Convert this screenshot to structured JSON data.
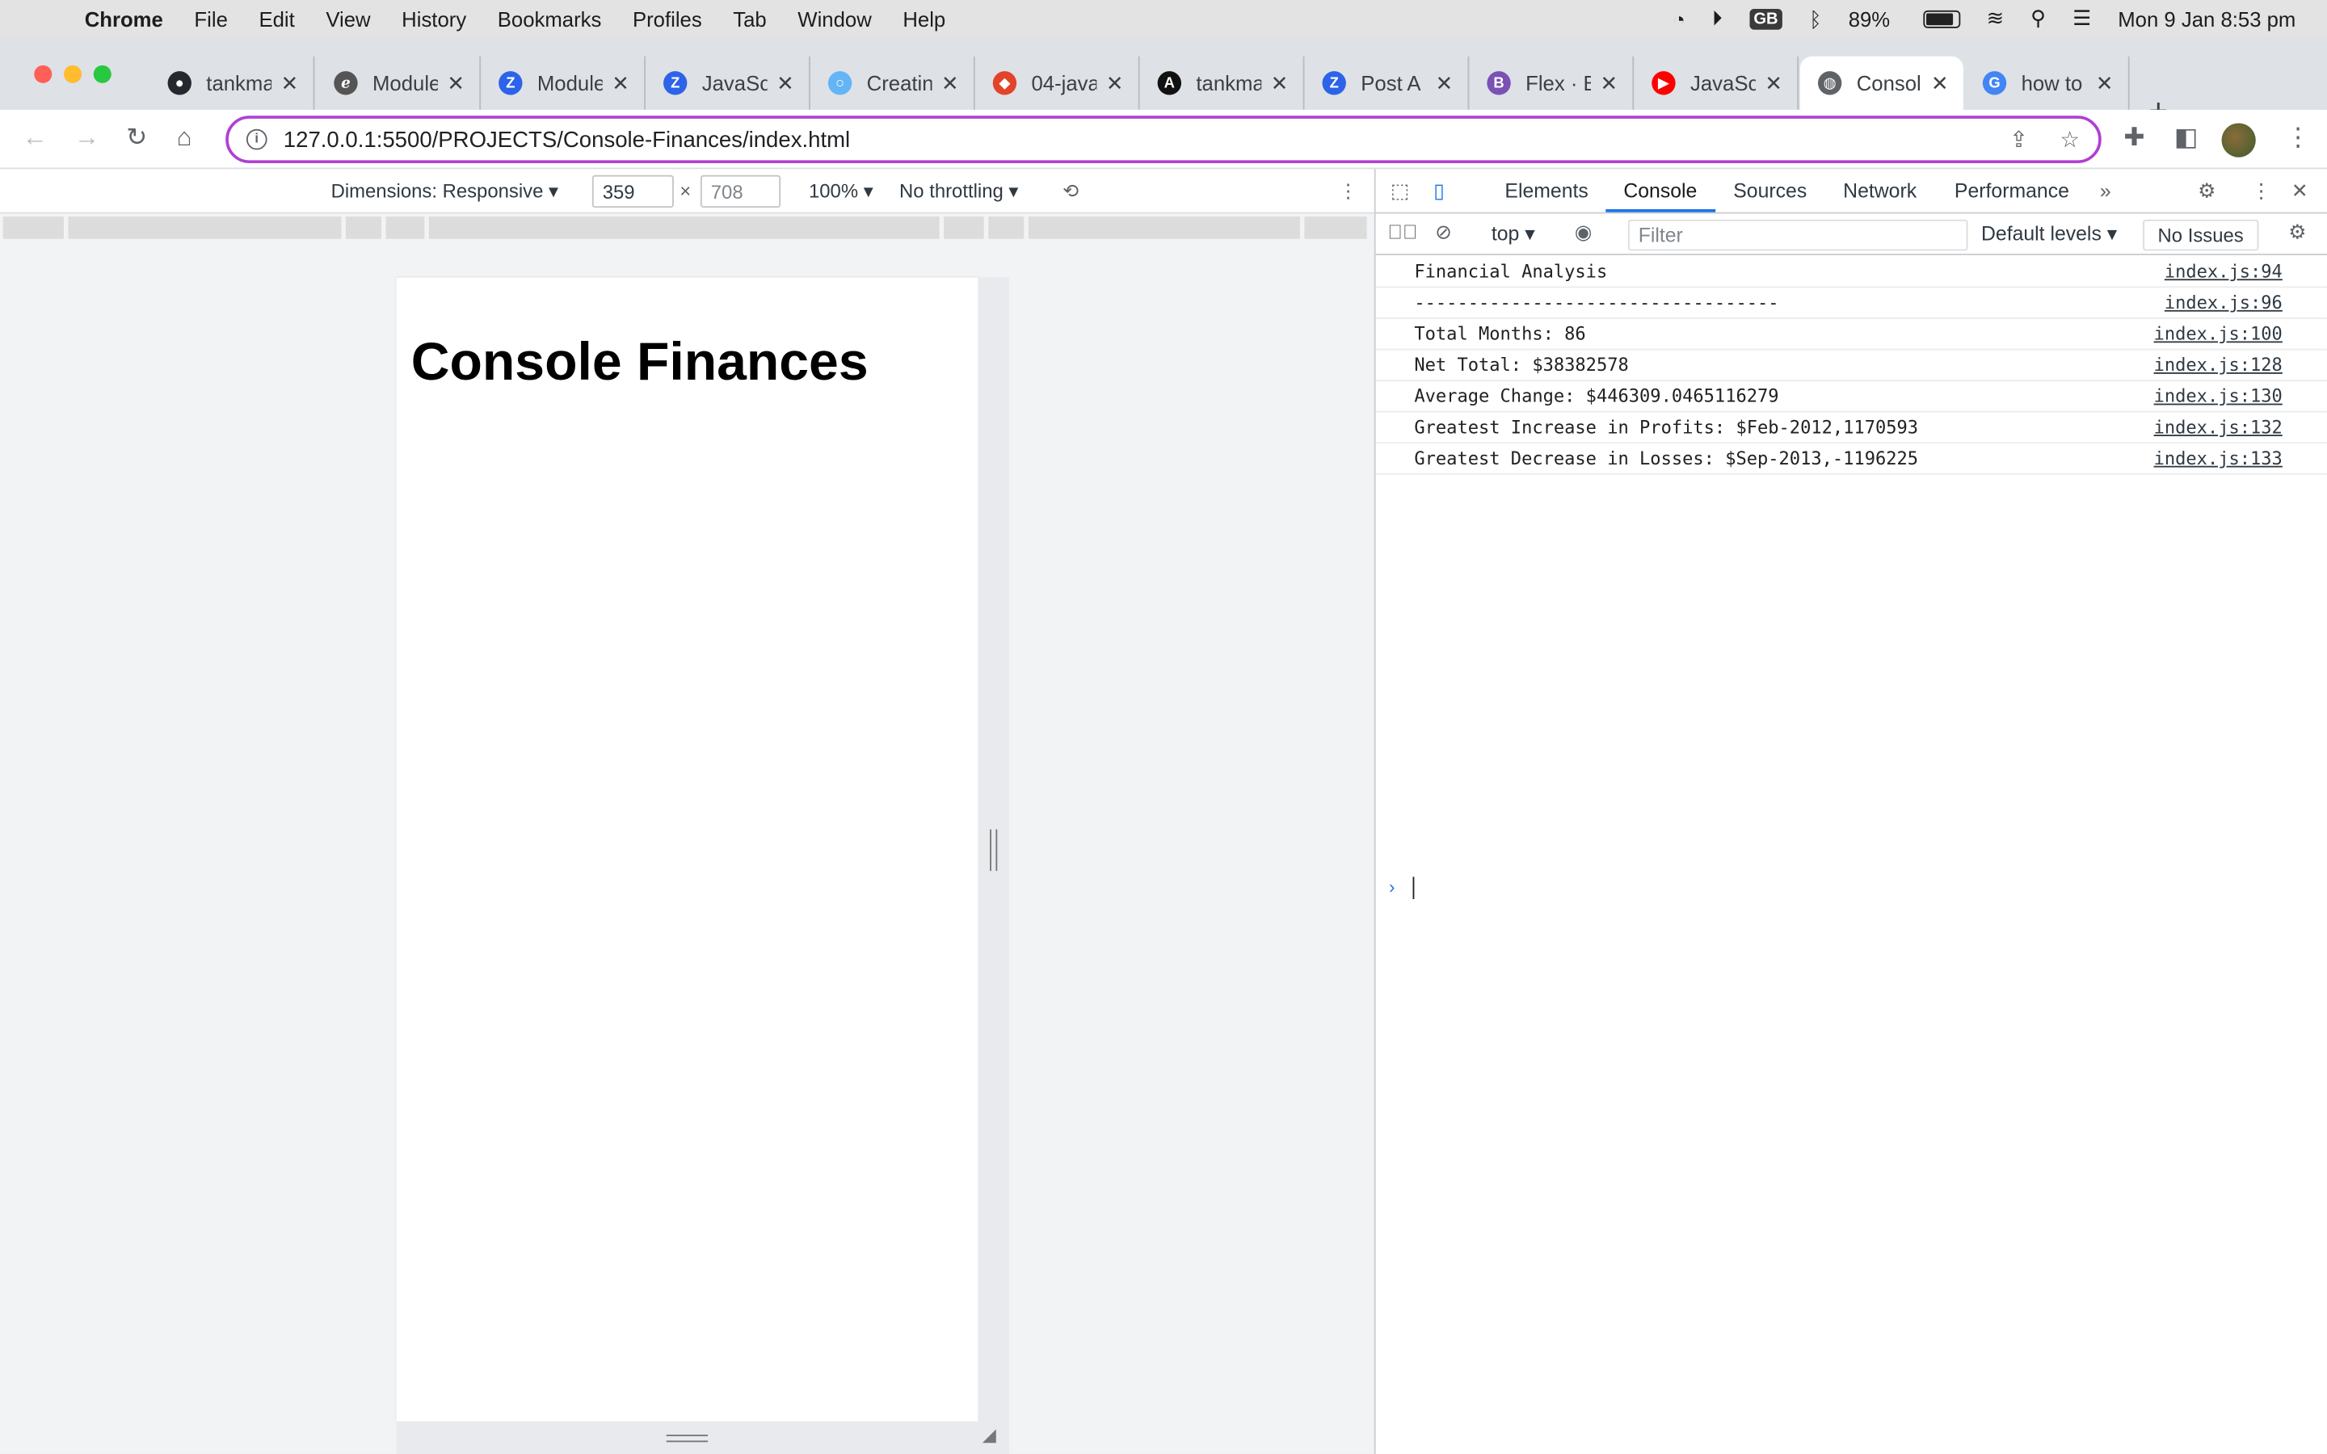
{
  "menubar": {
    "app": "Chrome",
    "items": [
      "File",
      "Edit",
      "View",
      "History",
      "Bookmarks",
      "Profiles",
      "Tab",
      "Window",
      "Help"
    ],
    "badge": "GB",
    "battery": "89%",
    "clock": "Mon 9 Jan  8:53 pm"
  },
  "tabs": [
    {
      "title": "tankma",
      "icon": "github-icon",
      "color": "#24292f"
    },
    {
      "title": "Module",
      "icon": "edx-icon",
      "color": "#555555"
    },
    {
      "title": "Module",
      "icon": "zoom-icon",
      "color": "#2d63e8"
    },
    {
      "title": "JavaSc",
      "icon": "zoom-icon",
      "color": "#2d63e8"
    },
    {
      "title": "Creatin",
      "icon": "circle-icon",
      "color": "#64b5f6"
    },
    {
      "title": "04-java",
      "icon": "gitlab-icon",
      "color": "#e24329"
    },
    {
      "title": "tankma",
      "icon": "aol-icon",
      "color": "#111111"
    },
    {
      "title": "Post A",
      "icon": "zoom-icon",
      "color": "#2d63e8"
    },
    {
      "title": "Flex · B",
      "icon": "bootstrap-icon",
      "color": "#7952b3"
    },
    {
      "title": "JavaSc",
      "icon": "youtube-icon",
      "color": "#ff0000"
    },
    {
      "title": "Consol",
      "icon": "globe-icon",
      "color": "#5f6368",
      "active": true
    },
    {
      "title": "how to",
      "icon": "google-icon",
      "color": "#4285f4"
    }
  ],
  "address": {
    "url": "127.0.0.1:5500/PROJECTS/Console-Finances/index.html"
  },
  "device_toolbar": {
    "dimensions": "Dimensions: Responsive",
    "width": "359",
    "height": "708",
    "zoom": "100%",
    "throttle": "No throttling"
  },
  "page": {
    "heading": "Console Finances"
  },
  "devtools": {
    "tabs": [
      "Elements",
      "Console",
      "Sources",
      "Network",
      "Performance"
    ],
    "active_tab": "Console",
    "context": "top",
    "filter_placeholder": "Filter",
    "levels": "Default levels",
    "issues": "No Issues",
    "logs": [
      {
        "msg": "Financial Analysis",
        "src": "index.js:94"
      },
      {
        "msg": "----------------------------------",
        "src": "index.js:96"
      },
      {
        "msg": "Total Months: 86",
        "src": "index.js:100"
      },
      {
        "msg": "Net Total: $38382578",
        "src": "index.js:128"
      },
      {
        "msg": "Average Change: $446309.0465116279",
        "src": "index.js:130"
      },
      {
        "msg": "Greatest Increase in Profits: $Feb-2012,1170593",
        "src": "index.js:132"
      },
      {
        "msg": "Greatest Decrease in Losses: $Sep-2013,-1196225",
        "src": "index.js:133"
      }
    ]
  }
}
